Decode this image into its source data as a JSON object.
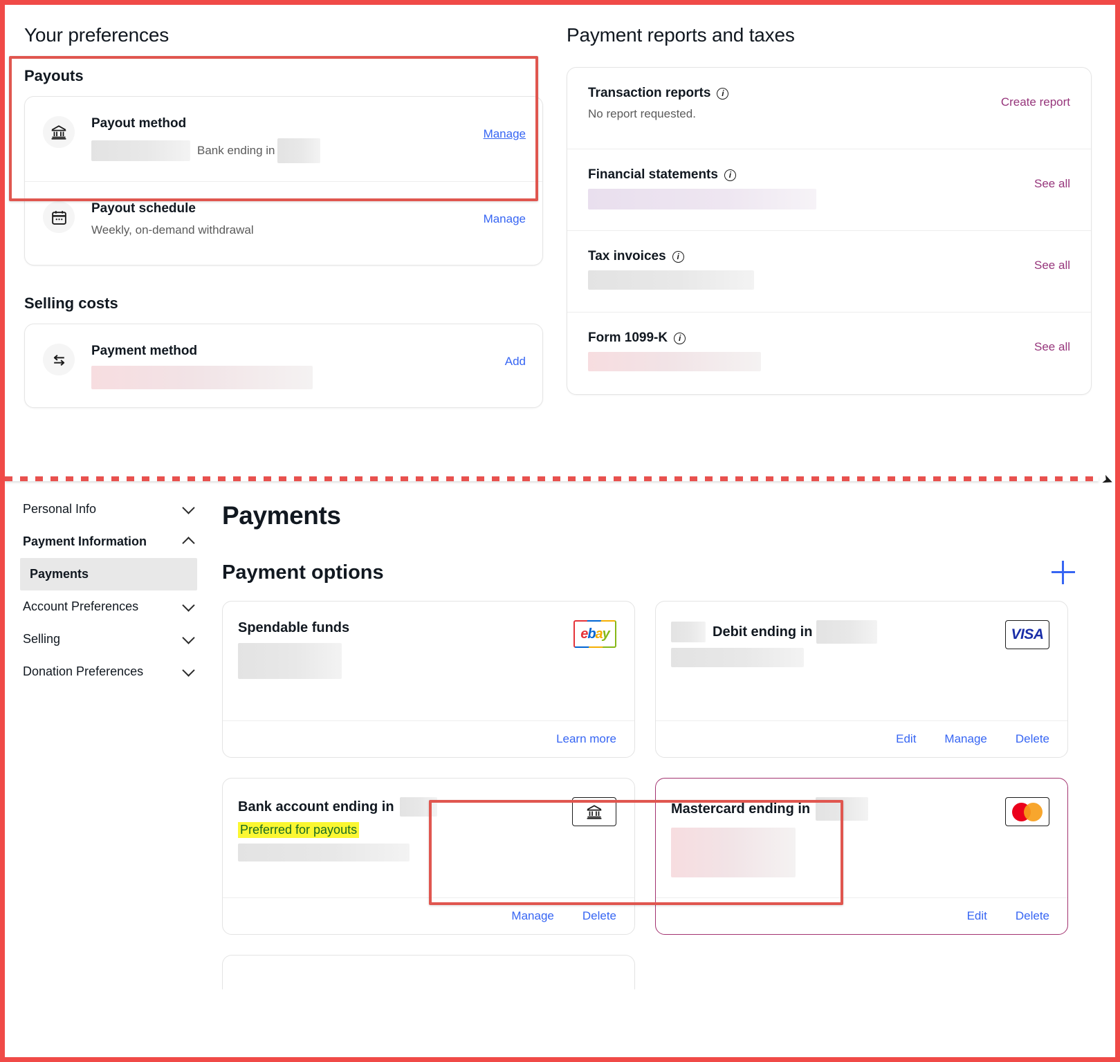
{
  "preferences": {
    "title": "Your preferences",
    "payouts": {
      "heading": "Payouts",
      "method": {
        "icon": "bank-icon",
        "title": "Payout method",
        "subtext": "Bank ending in",
        "action": "Manage"
      },
      "schedule": {
        "icon": "calendar-icon",
        "title": "Payout schedule",
        "subtext": "Weekly, on-demand withdrawal",
        "action": "Manage"
      }
    },
    "selling_costs": {
      "heading": "Selling costs",
      "payment_method": {
        "icon": "transfer-arrows-icon",
        "title": "Payment method",
        "action": "Add"
      }
    }
  },
  "reports": {
    "title": "Payment reports and taxes",
    "rows": [
      {
        "label": "Transaction reports",
        "desc": "No report requested.",
        "action": "Create report",
        "redacted": false
      },
      {
        "label": "Financial statements",
        "desc": "",
        "action": "See all",
        "redacted": true
      },
      {
        "label": "Tax invoices",
        "desc": "",
        "action": "See all",
        "redacted": true
      },
      {
        "label": "Form 1099-K",
        "desc": "",
        "action": "See all",
        "redacted": true
      }
    ]
  },
  "sidebar": {
    "items": [
      {
        "label": "Personal Info",
        "expanded": false,
        "bold": false
      },
      {
        "label": "Payment Information",
        "expanded": true,
        "bold": true
      },
      {
        "label": "Account Preferences",
        "expanded": false,
        "bold": false
      },
      {
        "label": "Selling",
        "expanded": false,
        "bold": false
      },
      {
        "label": "Donation Preferences",
        "expanded": false,
        "bold": false
      }
    ],
    "active_sub": "Payments"
  },
  "payments_page": {
    "title": "Payments",
    "options_title": "Payment options",
    "add_icon": "plus-icon",
    "cards": [
      {
        "title": "Spendable funds",
        "brand": "ebay",
        "badge": "",
        "actions": [
          "Learn more"
        ]
      },
      {
        "title": "Debit ending in",
        "brand": "visa",
        "badge": "",
        "actions": [
          "Edit",
          "Manage",
          "Delete"
        ]
      },
      {
        "title": "Bank account ending in",
        "brand": "bank",
        "badge": "Preferred for payouts",
        "actions": [
          "Manage",
          "Delete"
        ]
      },
      {
        "title": "Mastercard ending in",
        "brand": "mastercard",
        "badge": "",
        "actions": [
          "Edit",
          "Delete"
        ]
      }
    ]
  },
  "colors": {
    "highlight_border": "#e0564f",
    "link_blue": "#3665f3",
    "link_purple": "#96357b",
    "badge_bg": "#fbf732",
    "badge_text": "#1a6b22",
    "accent_card_border": "#a2326f"
  }
}
